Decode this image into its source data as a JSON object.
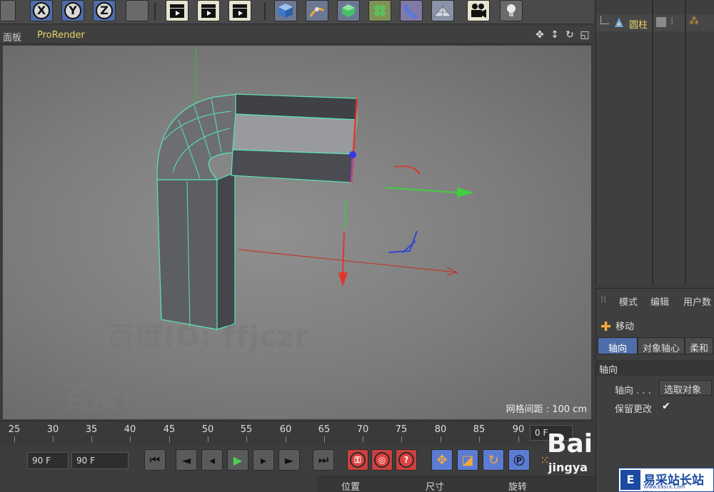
{
  "viewport": {
    "menu_panel": "面板",
    "menu_render": "ProRender",
    "grid_spacing": "网格间距 : 100 cm",
    "watermark_1": "百度ID: ffjczr",
    "watermark_2": "百度ID: ffjczr",
    "watermark_3": "百度ID: ffjczr"
  },
  "toolbar": {
    "axis_x": "X",
    "axis_y": "Y",
    "axis_z": "Z"
  },
  "timeline": {
    "ticks": [
      "25",
      "30",
      "35",
      "40",
      "45",
      "50",
      "55",
      "60",
      "65",
      "70",
      "75",
      "80",
      "85",
      "90"
    ],
    "current_frame": "0 F",
    "start_field": "90 F",
    "end_field": "90 F"
  },
  "object_manager": {
    "object_name": "圆柱"
  },
  "attributes": {
    "menu": [
      "模式",
      "编辑",
      "用户数"
    ],
    "tool_name": "移动",
    "tabs": [
      "轴向",
      "对象轴心",
      "柔和"
    ],
    "section": "轴向",
    "axis_label": "轴向 . . .",
    "axis_value": "选取对象",
    "keep_changes": "保留更改"
  },
  "coordinates": {
    "position": "位置",
    "size": "尺寸",
    "rotation": "旋转"
  },
  "overlay": {
    "baidu": "Bai",
    "jingyan": "jingya",
    "site_name": "易采站长站",
    "site_sub": "Www.Easck.Com Webmaster"
  }
}
